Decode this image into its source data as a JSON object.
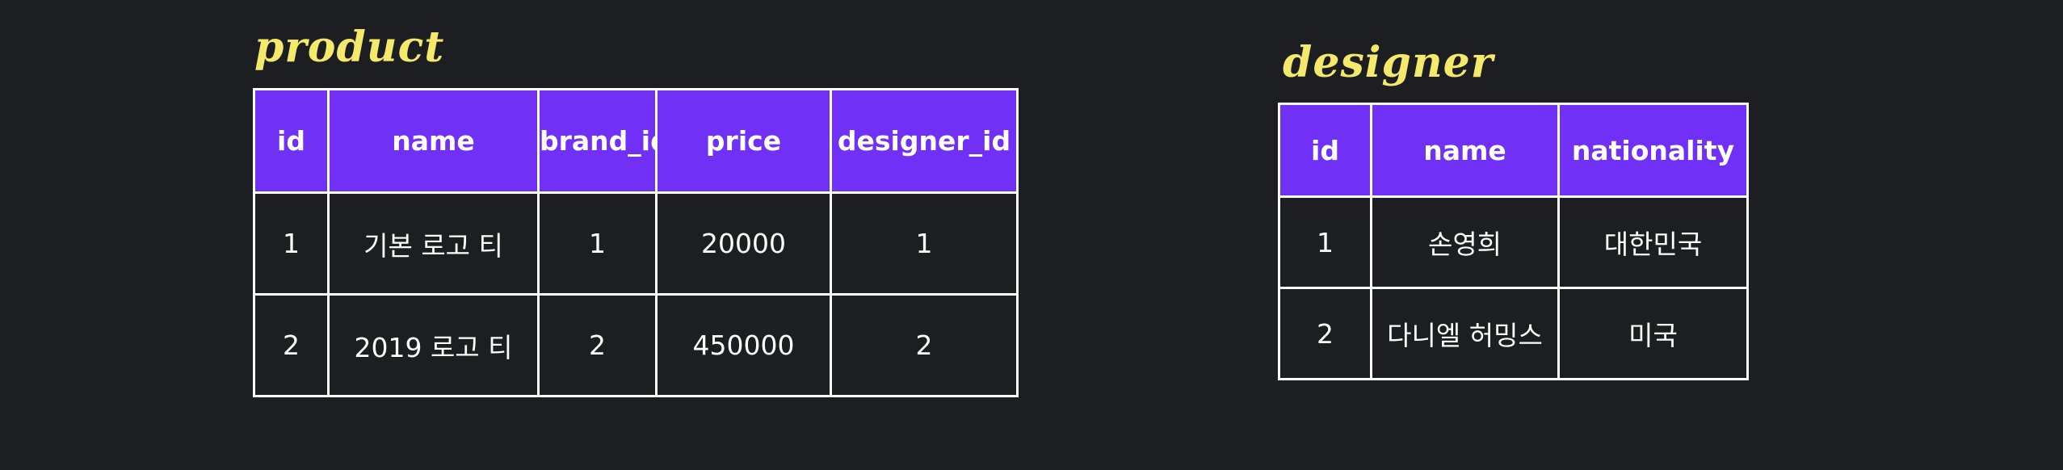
{
  "tables": [
    {
      "name": "product",
      "columns": [
        "id",
        "name",
        "brand_id",
        "price",
        "designer_id"
      ],
      "rows": [
        [
          "1",
          "기본 로고 티",
          "1",
          "20000",
          "1"
        ],
        [
          "2",
          "2019 로고 티",
          "2",
          "450000",
          "2"
        ]
      ]
    },
    {
      "name": "designer",
      "columns": [
        "id",
        "name",
        "nationality"
      ],
      "rows": [
        [
          "1",
          "손영희",
          "대한민국"
        ],
        [
          "2",
          "다니엘 허밍스",
          "미국"
        ]
      ]
    }
  ],
  "colors": {
    "background": "#1c1e22",
    "header_fill": "#7030f5",
    "title_text": "#f4e96a",
    "cell_text": "#ffffff",
    "border": "#ffffff"
  }
}
